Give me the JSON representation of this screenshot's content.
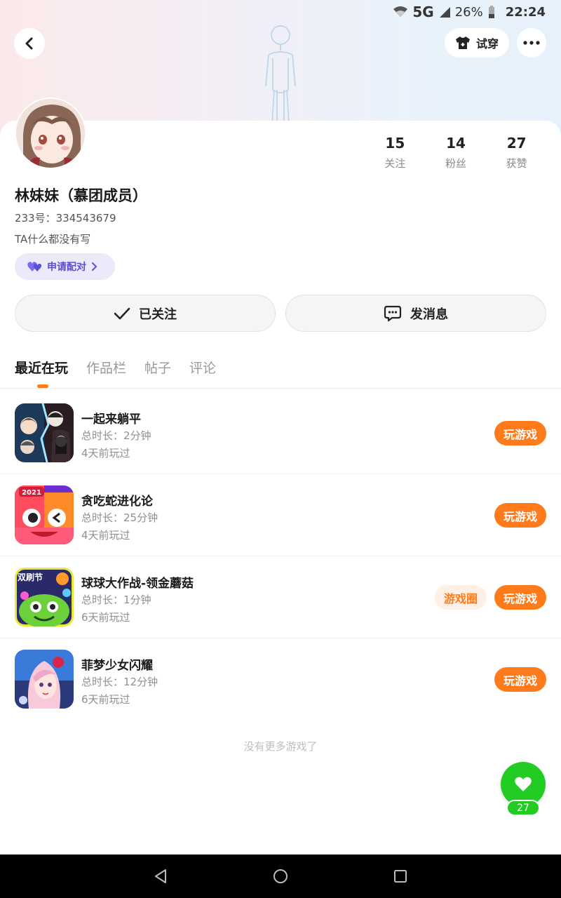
{
  "status_bar": {
    "network": "5G",
    "battery": "26%",
    "time": "22:24"
  },
  "header": {
    "tryon_label": "试穿"
  },
  "profile": {
    "name": "林妹妹（慕团成员）",
    "id_line": "233号：334543679",
    "bio": "TA什么都没有写",
    "match_label": "申请配对",
    "stats": [
      {
        "value": "15",
        "label": "关注"
      },
      {
        "value": "14",
        "label": "粉丝"
      },
      {
        "value": "27",
        "label": "获赞"
      }
    ]
  },
  "actions": {
    "follow_label": "已关注",
    "message_label": "发消息"
  },
  "tabs": [
    {
      "label": "最近在玩",
      "active": true
    },
    {
      "label": "作品栏",
      "active": false
    },
    {
      "label": "帖子",
      "active": false
    },
    {
      "label": "评论",
      "active": false
    }
  ],
  "games": [
    {
      "name": "一起来躺平",
      "duration": "总时长：2分钟",
      "last_played": "4天前玩过",
      "play_label": "玩游戏",
      "icon": "horror-game-icon"
    },
    {
      "name": "贪吃蛇进化论",
      "duration": "总时长：25分钟",
      "last_played": "4天前玩过",
      "play_label": "玩游戏",
      "icon": "snake-game-icon",
      "icon_badge": "2021"
    },
    {
      "name": "球球大作战-领金蘑菇",
      "duration": "总时长：1分钟",
      "last_played": "6天前玩过",
      "play_label": "玩游戏",
      "circle_label": "游戏圈",
      "icon": "ball-game-icon",
      "icon_badge": "双刷节"
    },
    {
      "name": "菲梦少女闪耀",
      "duration": "总时长：12分钟",
      "last_played": "6天前玩过",
      "play_label": "玩游戏",
      "icon": "girl-game-icon"
    }
  ],
  "footer": {
    "no_more_text": "没有更多游戏了"
  },
  "like": {
    "count": "27"
  },
  "colors": {
    "accent": "#ff7a1a",
    "like_green": "#22cc22",
    "match_purple": "#5b4fd6"
  }
}
